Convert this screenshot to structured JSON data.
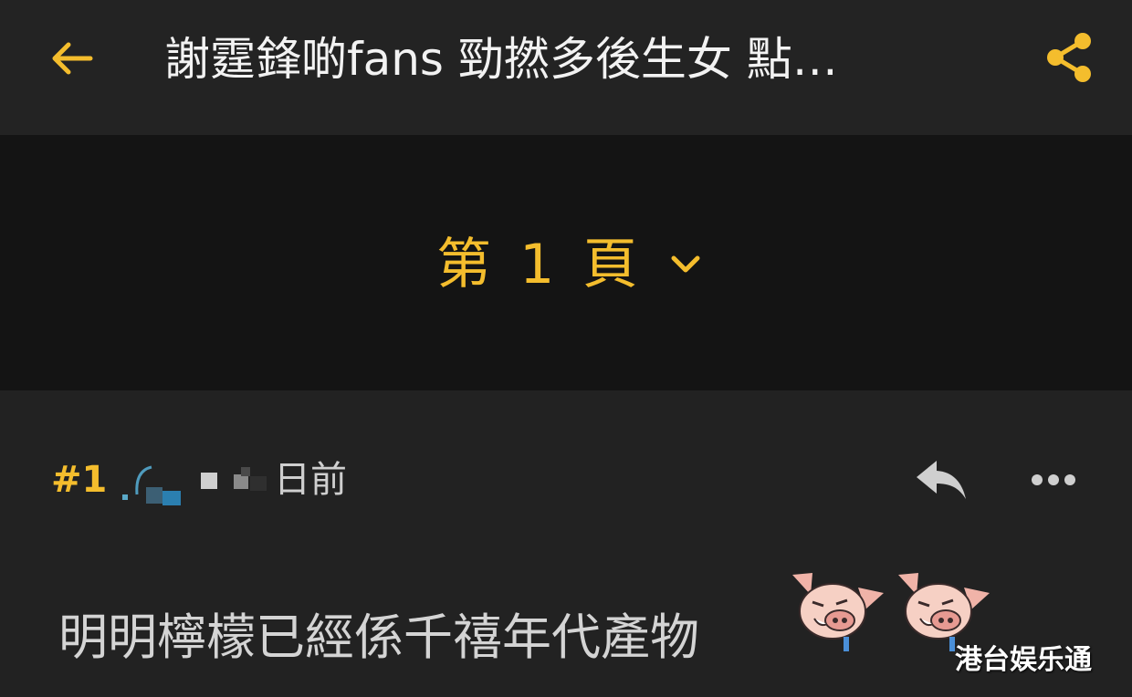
{
  "header": {
    "title": "謝霆鋒啲fans 勁撚多後生女 點…",
    "back_icon": "arrow-left-icon",
    "share_icon": "share-icon"
  },
  "pagination": {
    "label": "第 1 頁",
    "chevron_icon": "chevron-down-icon"
  },
  "post": {
    "number": "#1",
    "time": "日前",
    "reply_icon": "reply-icon",
    "more_icon": "more-icon",
    "content": "明明檸檬已經係千禧年代產物",
    "emoji_icons": [
      "pig-crying-emoji",
      "pig-crying-emoji"
    ]
  },
  "watermark": "港台娱乐通",
  "colors": {
    "accent": "#f4bd2d",
    "header_bg": "#232323",
    "pagebar_bg": "#141414",
    "post_bg": "#222222"
  }
}
